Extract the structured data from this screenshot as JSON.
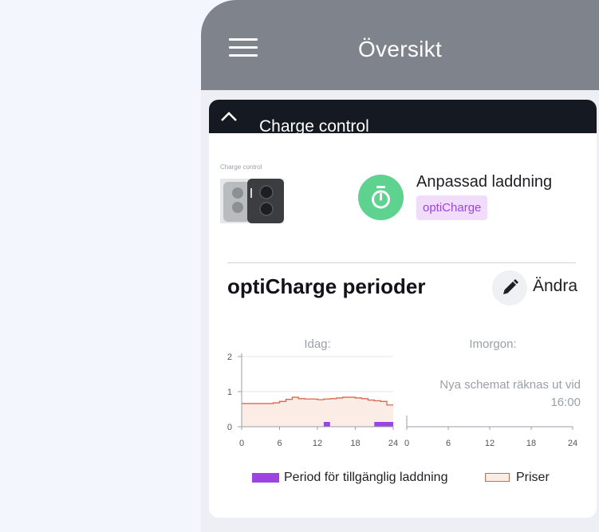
{
  "appbar": {
    "title": "Översikt",
    "menu_icon": "hamburger-menu-icon"
  },
  "card": {
    "title": "Charge control",
    "collapse_icon": "chevron-up-icon",
    "thumbnail_label": "Charge control",
    "mode_icon": "stopwatch-icon",
    "mode_title": "Anpassad laddning",
    "mode_badge": "optiCharge"
  },
  "periods": {
    "title": "optiCharge perioder",
    "edit_label": "Ändra",
    "edit_icon": "pencil-icon"
  },
  "chart_data": [
    {
      "type": "line",
      "title": "Idag:",
      "x_ticks": [
        "0",
        "6",
        "12",
        "18",
        "24"
      ],
      "y_ticks": [
        "0",
        "1",
        "2"
      ],
      "ylim": [
        0,
        2
      ],
      "xlim": [
        0,
        24
      ],
      "series": [
        {
          "name": "Priser",
          "style": "step-area",
          "color": "#d8694a",
          "fill": "#fbece5",
          "x": [
            0,
            1,
            2,
            3,
            4,
            5,
            6,
            7,
            8,
            9,
            10,
            11,
            12,
            13,
            14,
            15,
            16,
            17,
            18,
            19,
            20,
            21,
            22,
            23,
            24
          ],
          "values": [
            0.66,
            0.66,
            0.66,
            0.66,
            0.66,
            0.68,
            0.72,
            0.78,
            0.84,
            0.8,
            0.79,
            0.79,
            0.77,
            0.79,
            0.8,
            0.82,
            0.84,
            0.84,
            0.82,
            0.8,
            0.76,
            0.74,
            0.72,
            0.62,
            0.62
          ]
        },
        {
          "name": "Period för tillgänglig laddning",
          "style": "bars",
          "color": "#9b44e4",
          "periods": [
            [
              13,
              14
            ],
            [
              21,
              24
            ]
          ]
        }
      ]
    },
    {
      "type": "line",
      "title": "Imorgon:",
      "x_ticks": [
        "0",
        "6",
        "12",
        "18",
        "24"
      ],
      "xlim": [
        0,
        24
      ],
      "message": "Nya schemat räknas ut vid 16:00",
      "series": []
    }
  ],
  "legend": {
    "items": [
      {
        "label": "Period för tillgänglig laddning",
        "color": "#9b44e4"
      },
      {
        "label": "Priser",
        "color": "#d8694a"
      }
    ]
  }
}
